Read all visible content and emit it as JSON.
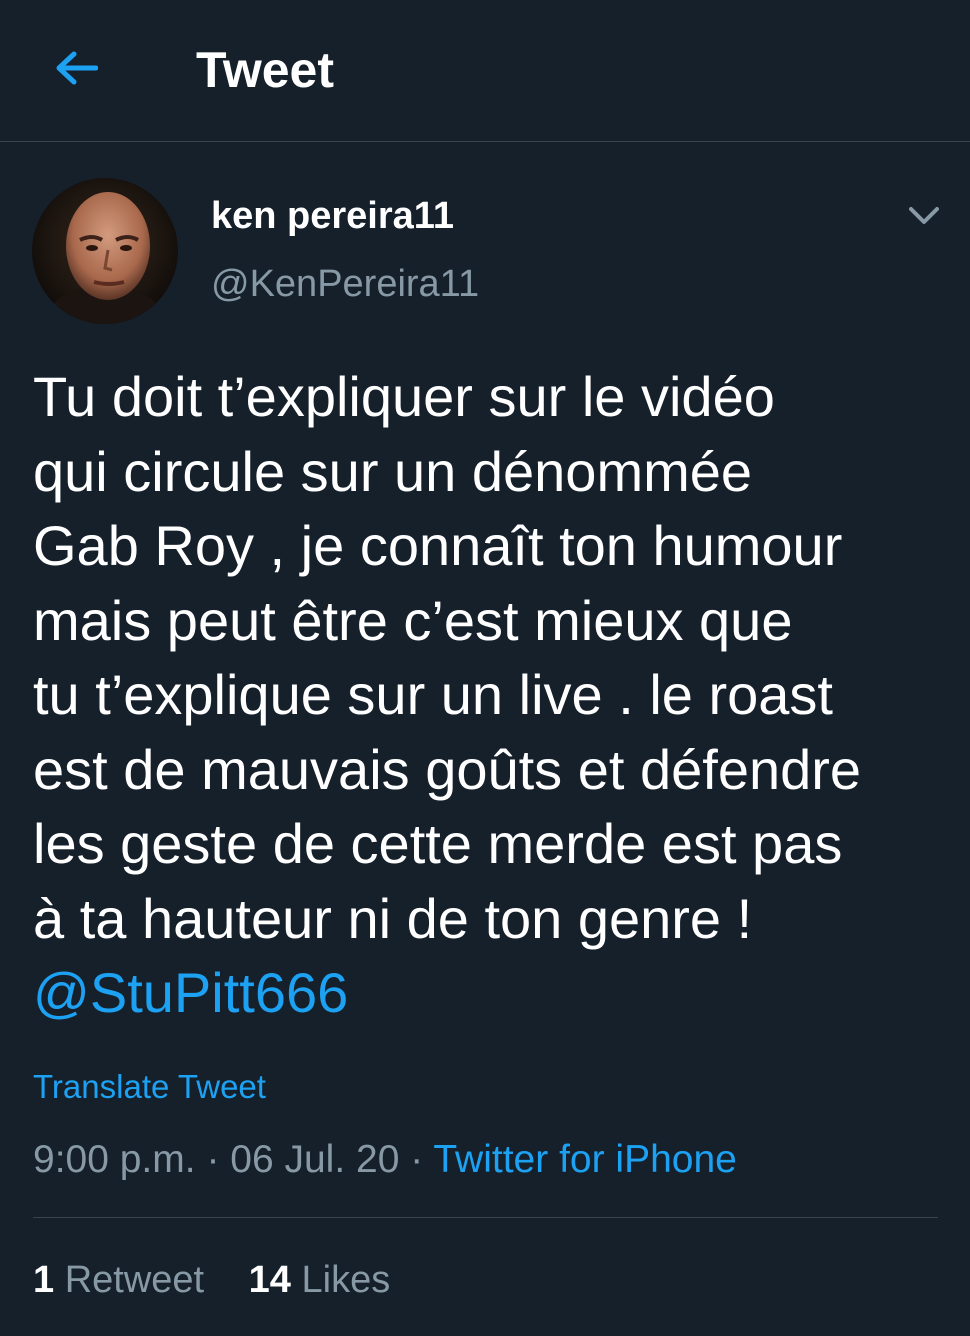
{
  "header": {
    "title": "Tweet",
    "back_icon": "arrow-left-icon",
    "accent_color": "#1da1f2"
  },
  "author": {
    "display_name": "ken pereira11",
    "handle": "@KenPereira11",
    "avatar_icon": "user-avatar",
    "menu_icon": "chevron-down-icon"
  },
  "tweet": {
    "lines": [
      "Tu doit t’expliquer sur le vidéo",
      "qui circule sur un dénommée",
      "Gab Roy , je connaît ton humour",
      "mais peut être c’est mieux que",
      "tu t’explique sur un live . le roast",
      "est de mauvais goûts et défendre",
      "les geste de cette merde est pas",
      "à ta hauteur ni de ton genre !"
    ],
    "mention": "@StuPitt666",
    "translate_label": "Translate Tweet",
    "time": "9:00 p.m.",
    "separator": "·",
    "date": "06 Jul. 20",
    "source": "Twitter for iPhone"
  },
  "stats": {
    "retweet_count": "1",
    "retweet_label": "Retweet",
    "like_count": "14",
    "like_label": "Likes"
  },
  "colors": {
    "background": "#15202b",
    "muted_text": "#8899a6",
    "divider": "#38444d"
  }
}
